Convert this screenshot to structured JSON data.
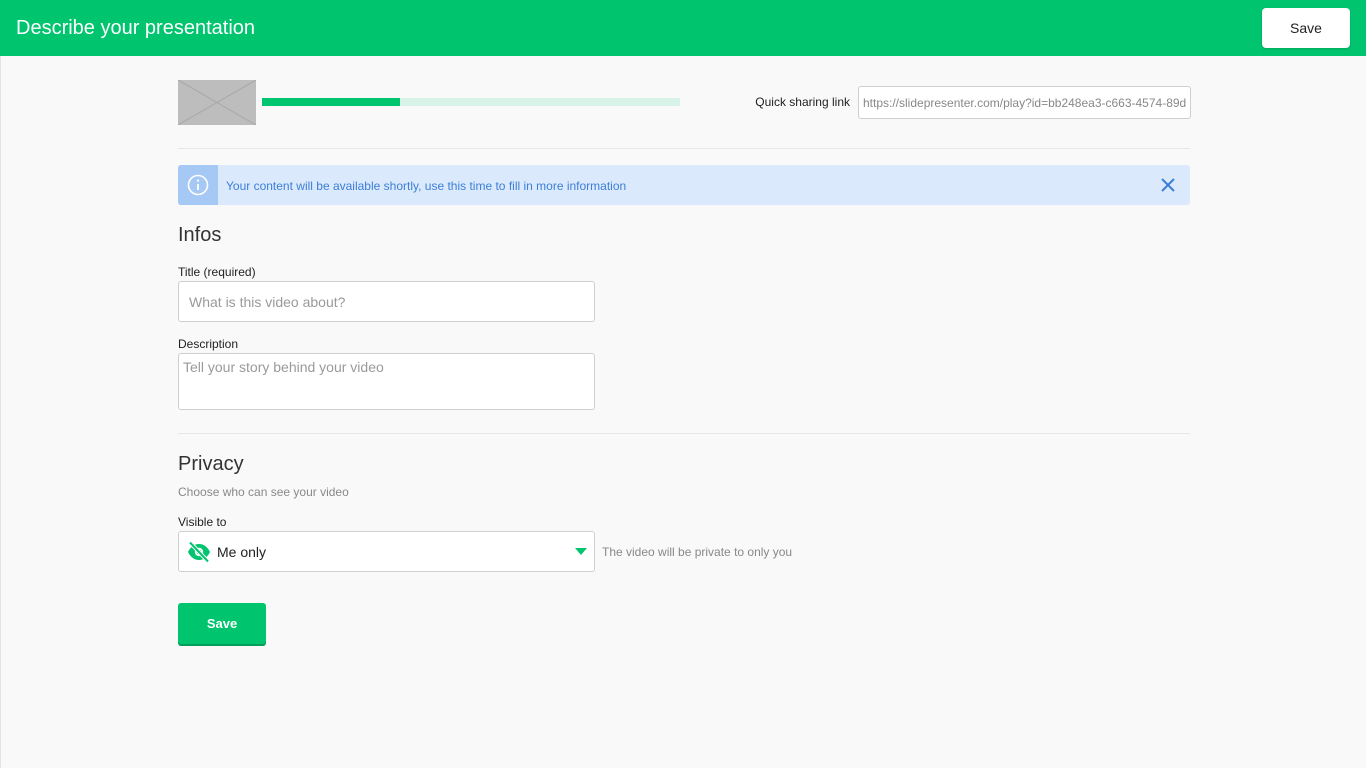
{
  "header": {
    "title": "Describe your presentation",
    "save_label": "Save"
  },
  "upload": {
    "progress_percent": 33,
    "share_label": "Quick sharing link",
    "share_url": "https://slidepresenter.com/play?id=bb248ea3-c663-4574-89d"
  },
  "alert": {
    "icon": "info-icon",
    "message": "Your content will be available shortly, use this time to fill in more information",
    "close_icon": "close-icon"
  },
  "infos": {
    "heading": "Infos",
    "title_label": "Title (required)",
    "title_placeholder": "What is this video about?",
    "description_label": "Description",
    "description_placeholder": "Tell your story behind your video"
  },
  "privacy": {
    "heading": "Privacy",
    "subtitle": "Choose who can see your video",
    "visible_label": "Visible to",
    "visible_icon": "eye-off-icon",
    "visible_value": "Me only",
    "visible_hint": "The video will be private to only you"
  },
  "footer": {
    "save_label": "Save"
  },
  "colors": {
    "brand": "#00c46e",
    "alert_bg": "#dbe9fd",
    "alert_text": "#3c7fd6"
  }
}
